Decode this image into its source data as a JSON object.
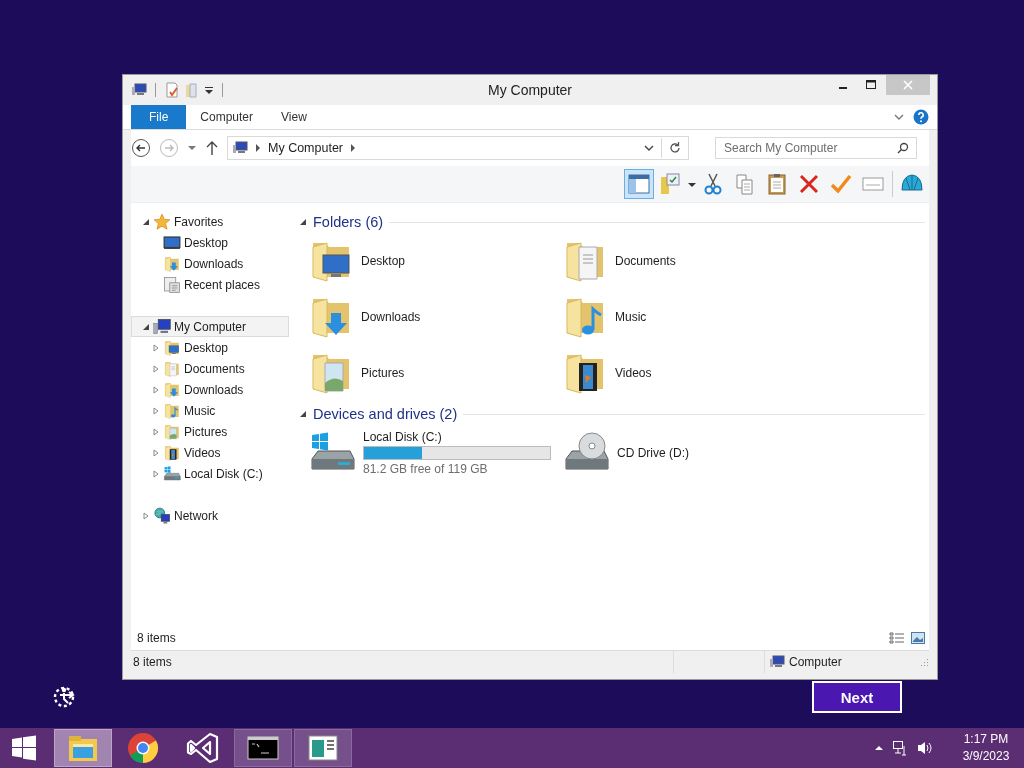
{
  "window": {
    "title": "My Computer"
  },
  "ribbon_tabs": [
    {
      "label": "File",
      "selected": true
    },
    {
      "label": "Computer",
      "selected": false
    },
    {
      "label": "View",
      "selected": false
    }
  ],
  "address": {
    "path": "My Computer"
  },
  "search": {
    "placeholder": "Search My Computer"
  },
  "toolbar": [
    {
      "kind": "pane",
      "selected": true
    },
    {
      "kind": "properties"
    },
    {
      "kind": "cut"
    },
    {
      "kind": "copy"
    },
    {
      "kind": "paste"
    },
    {
      "kind": "delete"
    },
    {
      "kind": "check"
    },
    {
      "kind": "rename"
    },
    {
      "kind": "shell"
    }
  ],
  "nav": [
    {
      "label": "Favorites",
      "kind": "star",
      "expanded": true,
      "selected": false,
      "children": [
        {
          "label": "Desktop",
          "kind": "monitor",
          "selected": false
        },
        {
          "label": "Downloads",
          "kind": "downloads",
          "selected": false
        },
        {
          "label": "Recent places",
          "kind": "recent",
          "selected": false
        }
      ]
    },
    {
      "label": "My Computer",
      "kind": "computer",
      "expanded": true,
      "selected": true,
      "children": [
        {
          "label": "Desktop",
          "kind": "desktop",
          "expanded": false,
          "selected": false
        },
        {
          "label": "Documents",
          "kind": "documents",
          "expanded": false,
          "selected": false
        },
        {
          "label": "Downloads",
          "kind": "downloads",
          "expanded": false,
          "selected": false
        },
        {
          "label": "Music",
          "kind": "music",
          "expanded": false,
          "selected": false
        },
        {
          "label": "Pictures",
          "kind": "pictures",
          "expanded": false,
          "selected": false
        },
        {
          "label": "Videos",
          "kind": "videos",
          "expanded": false,
          "selected": false
        },
        {
          "label": "Local Disk (C:)",
          "kind": "hdd",
          "expanded": false,
          "selected": false
        }
      ]
    },
    {
      "label": "Network",
      "kind": "network",
      "expanded": false,
      "selected": false
    }
  ],
  "folders": {
    "title": "Folders (6)",
    "expanded": true,
    "items": [
      {
        "label": "Desktop",
        "kind": "desktop"
      },
      {
        "label": "Documents",
        "kind": "documents"
      },
      {
        "label": "Downloads",
        "kind": "downloads"
      },
      {
        "label": "Music",
        "kind": "music"
      },
      {
        "label": "Pictures",
        "kind": "pictures"
      },
      {
        "label": "Videos",
        "kind": "videos"
      }
    ]
  },
  "drives": {
    "title": "Devices and drives (2)",
    "expanded": true,
    "items": [
      {
        "label": "Local Disk (C:)",
        "kind": "hdd",
        "level": 0.31,
        "free": "81.2 GB free of 119 GB"
      },
      {
        "label": "CD Drive (D:)",
        "kind": "cd"
      }
    ]
  },
  "pane_status": "8 items",
  "status_bar": {
    "count": "8 items",
    "location": "Computer"
  },
  "next_button": "Next",
  "taskbar": [
    {
      "kind": "explorer",
      "selected": true,
      "running": true
    },
    {
      "kind": "chrome",
      "selected": false,
      "running": false
    },
    {
      "kind": "vs",
      "selected": false,
      "running": false
    },
    {
      "kind": "terminal",
      "selected": false,
      "running": true
    },
    {
      "kind": "app",
      "selected": false,
      "running": true
    }
  ],
  "clock": {
    "time": "1:17 PM",
    "date": "3/9/2023"
  }
}
